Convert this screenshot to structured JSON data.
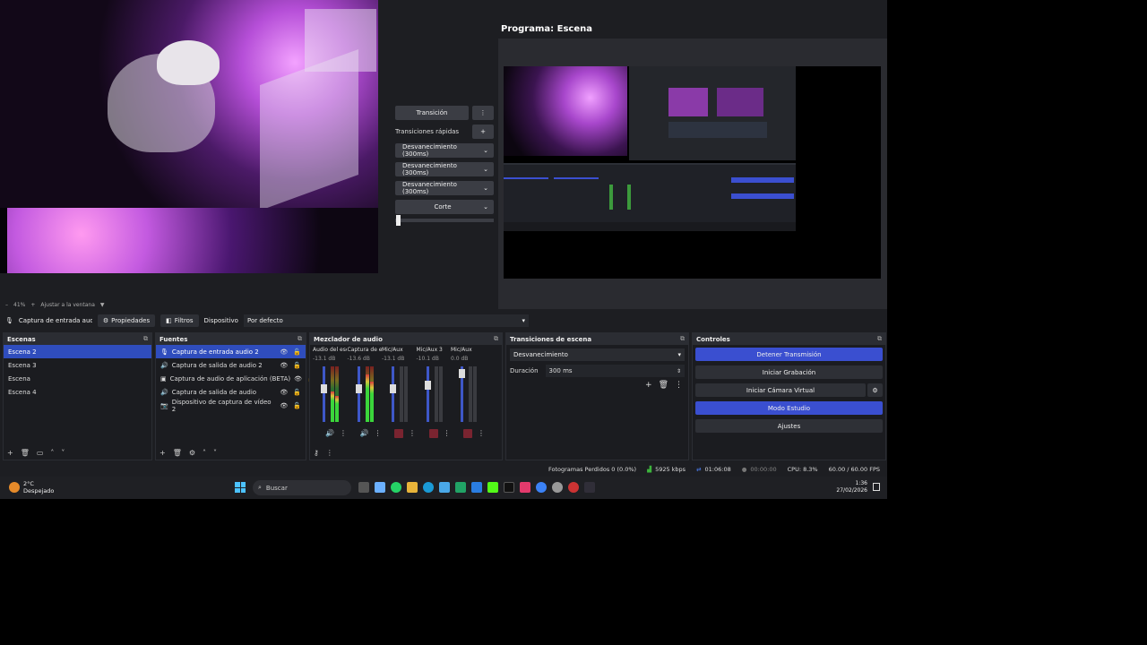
{
  "window": {
    "minimize": "–",
    "maximize": "❐",
    "close": "✕"
  },
  "preview": {
    "zoom_minus": "–",
    "zoom_percent": "41%",
    "zoom_plus": "+",
    "fit_label": "Ajustar a la ventana",
    "fit_caret": "▼"
  },
  "transition_panel": {
    "transition_button": "Transición",
    "more": "⋮",
    "quick_label": "Transiciones rápidas",
    "add": "+",
    "quick_items": [
      "Desvanecimiento (300ms)",
      "Desvanecimiento (300ms)",
      "Desvanecimiento (300ms)",
      "Corte"
    ],
    "caret": "⌄"
  },
  "program": {
    "title": "Programa: Escena"
  },
  "source_bar": {
    "mic_icon": "🎙",
    "source_name": "Captura de entrada audio 2",
    "properties": "Propiedades",
    "filters": "Filtros",
    "device_label": "Dispositivo",
    "device_value": "Por defecto",
    "caret": "▾"
  },
  "scenes": {
    "title": "Escenas",
    "items": [
      "Escena 2",
      "Escena 3",
      "Escena",
      "Escena 4"
    ],
    "footer": [
      "+",
      "🗑",
      "▭",
      "˄",
      "˅"
    ]
  },
  "sources": {
    "title": "Fuentes",
    "items": [
      {
        "icon": "🎙",
        "label": "Captura de entrada audio 2"
      },
      {
        "icon": "🔊",
        "label": "Captura de salida de audio 2"
      },
      {
        "icon": "▣",
        "label": "Captura de audio de aplicación (BETA)"
      },
      {
        "icon": "🔊",
        "label": "Captura de salida de audio"
      },
      {
        "icon": "📷",
        "label": "Dispositivo de captura de vídeo 2"
      }
    ],
    "eye": "👁",
    "lock": "🔓",
    "footer": [
      "+",
      "🗑",
      "⚙",
      "˄",
      "˅"
    ]
  },
  "mixer": {
    "title": "Mezclador de audio",
    "channels": [
      {
        "name": "Audio del escritorio",
        "db": "-13.1 dB",
        "level": 0.55,
        "fader": 0.62,
        "muted": false
      },
      {
        "name": "Captura de entrada",
        "db": "-13.6 dB",
        "level": 0.85,
        "fader": 0.62,
        "muted": false
      },
      {
        "name": "Mic/Aux",
        "db": "-13.1 dB",
        "level": 0.0,
        "fader": 0.62,
        "muted": true
      },
      {
        "name": "Mic/Aux 3",
        "db": "-10.1 dB",
        "level": 0.0,
        "fader": 0.7,
        "muted": true
      },
      {
        "name": "Mic/Aux",
        "db": "0.0 dB",
        "level": 0.0,
        "fader": 0.95,
        "muted": true
      }
    ],
    "footer": [
      "⚷",
      "⋮"
    ],
    "speaker": "🔊",
    "more": "⋮"
  },
  "scene_transitions": {
    "title": "Transiciones de escena",
    "selected": "Desvanecimiento",
    "duration_label": "Duración",
    "duration_value": "300 ms",
    "add": "+",
    "remove": "🗑",
    "more": "⋮"
  },
  "controls": {
    "title": "Controles",
    "stop_stream": "Detener Transmisión",
    "start_recording": "Iniciar Grabación",
    "virtual_camera": "Iniciar Cámara Virtual",
    "studio_mode": "Modo Estudio",
    "settings": "Ajustes",
    "gear": "⚙"
  },
  "status": {
    "dropped_frames": "Fotogramas Perdidos 0 (0.0%)",
    "bitrate": "5925 kbps",
    "stream_time": "01:06:08",
    "rec_time": "00:00:00",
    "cpu": "CPU: 8.3%",
    "fps": "60.00 / 60.00 FPS"
  },
  "taskbar": {
    "temp": "2°C",
    "weather": "Despejado",
    "search": "Buscar",
    "time": "1:36",
    "date": "27/02/2026"
  },
  "colors": {
    "accent": "#3a4fd0",
    "dock_bg": "#1b1c20",
    "header_bg": "#2b2d33"
  }
}
